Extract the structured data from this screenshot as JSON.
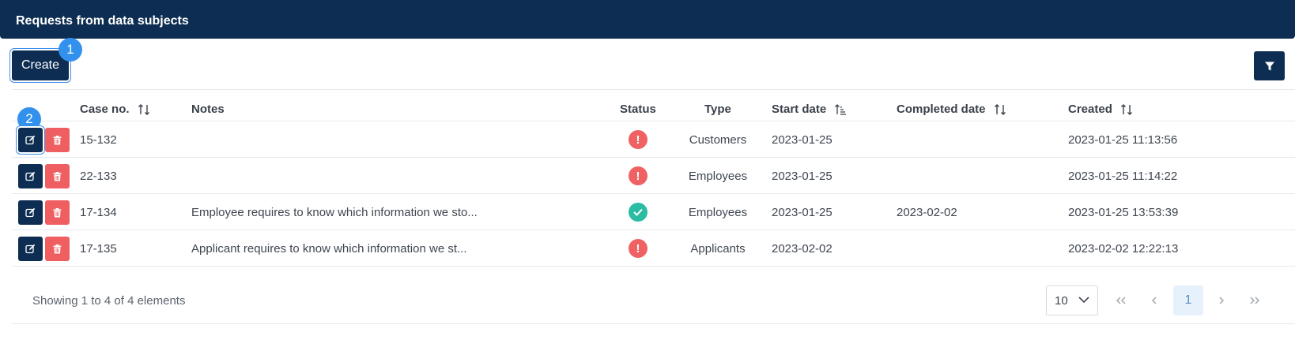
{
  "header": {
    "title": "Requests from data subjects"
  },
  "toolbar": {
    "create_label": "Create",
    "badge_1": "1",
    "badge_2": "2",
    "filter_icon": "filter-icon"
  },
  "table": {
    "columns": {
      "case_no": "Case no.",
      "notes": "Notes",
      "status": "Status",
      "type": "Type",
      "start_date": "Start date",
      "completed_date": "Completed date",
      "created": "Created"
    },
    "rows": [
      {
        "case_no": "15-132",
        "notes": "",
        "status": "pending",
        "type": "Customers",
        "start_date": "2023-01-25",
        "completed_date": "",
        "created": "2023-01-25 11:13:56"
      },
      {
        "case_no": "22-133",
        "notes": "",
        "status": "pending",
        "type": "Employees",
        "start_date": "2023-01-25",
        "completed_date": "",
        "created": "2023-01-25 11:14:22"
      },
      {
        "case_no": "17-134",
        "notes": "Employee requires to know which information we sto...",
        "status": "completed",
        "type": "Employees",
        "start_date": "2023-01-25",
        "completed_date": "2023-02-02",
        "created": "2023-01-25 13:53:39"
      },
      {
        "case_no": "17-135",
        "notes": "Applicant requires to know which information we st...",
        "status": "pending",
        "type": "Applicants",
        "start_date": "2023-02-02",
        "completed_date": "",
        "created": "2023-02-02 12:22:13"
      }
    ]
  },
  "footer": {
    "summary": "Showing 1 to 4 of 4 elements",
    "page_size": "10",
    "current_page": "1"
  },
  "colors": {
    "primary": "#0d2e52",
    "danger": "#ef5f61",
    "success": "#2cbca3",
    "badge": "#3391ee"
  }
}
